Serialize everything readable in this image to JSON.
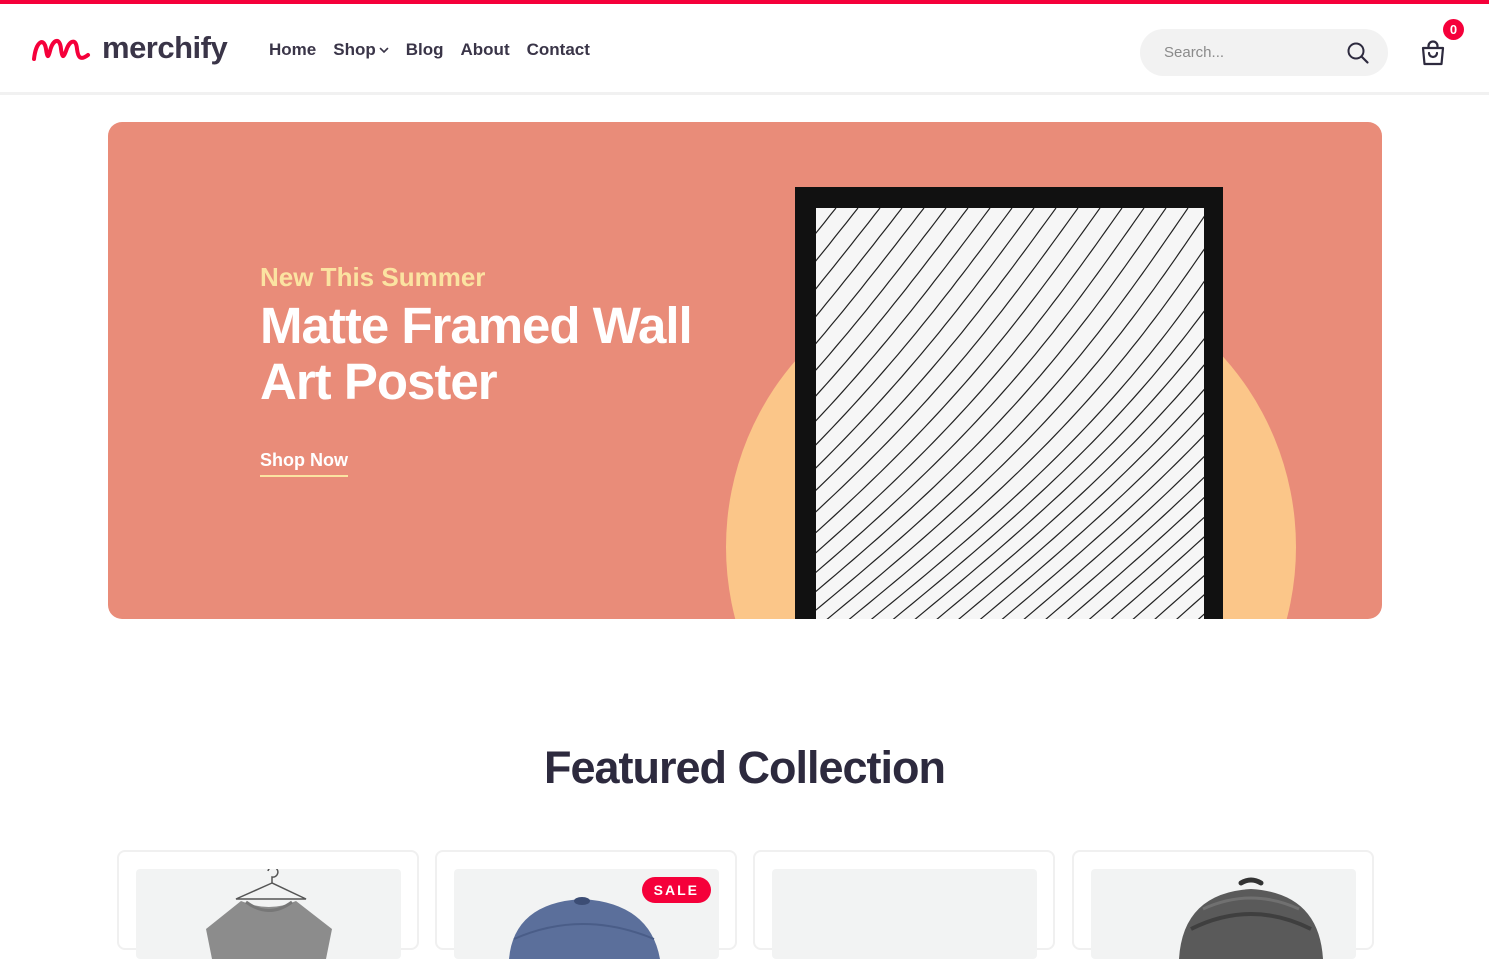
{
  "brand": {
    "name": "merchify",
    "accent": "#f5003a"
  },
  "nav": [
    {
      "label": "Home"
    },
    {
      "label": "Shop",
      "has_dropdown": true
    },
    {
      "label": "Blog"
    },
    {
      "label": "About"
    },
    {
      "label": "Contact"
    }
  ],
  "search": {
    "placeholder": "Search...",
    "value": ""
  },
  "cart": {
    "count": "0"
  },
  "hero": {
    "eyebrow": "New This Summer",
    "title": "Matte Framed Wall Art Poster",
    "cta": "Shop Now",
    "colors": {
      "background": "#e98c79",
      "circle": "#fbc689",
      "eyebrow": "#fbe3a1"
    }
  },
  "featured": {
    "title": "Featured Collection",
    "products": [
      {
        "image": "t-shirt",
        "badge": ""
      },
      {
        "image": "cap",
        "badge": "SALE"
      },
      {
        "image": "",
        "badge": ""
      },
      {
        "image": "backpack",
        "badge": ""
      }
    ]
  }
}
